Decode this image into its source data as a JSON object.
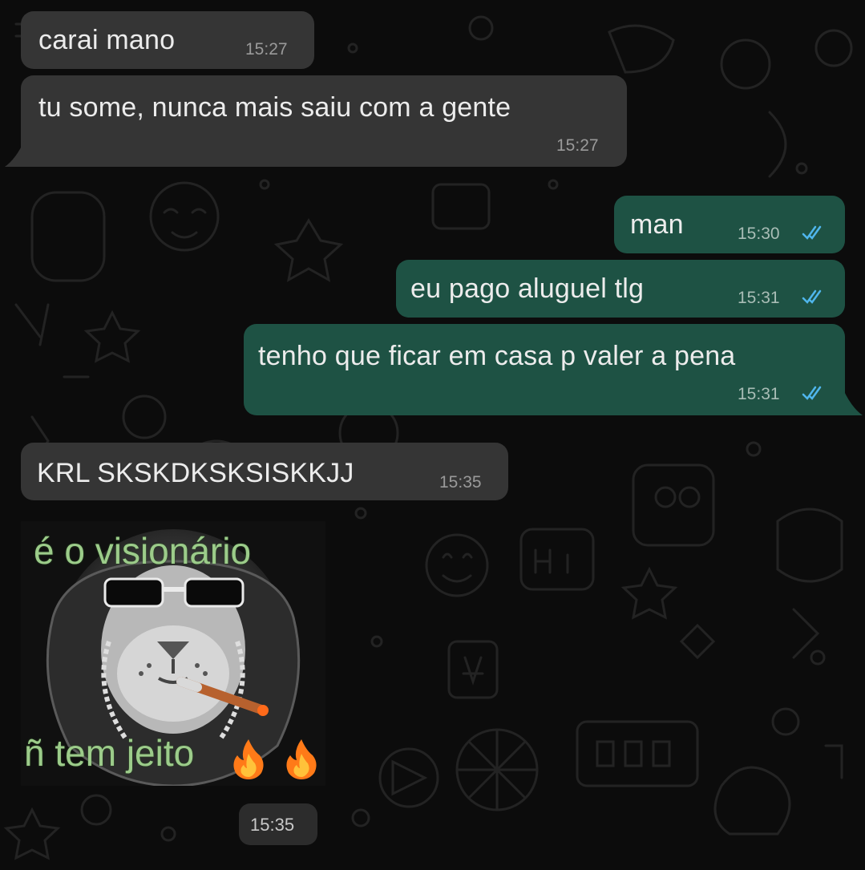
{
  "messages": [
    {
      "direction": "incoming",
      "text": "carai mano",
      "time": "15:27"
    },
    {
      "direction": "incoming",
      "text": "tu some, nunca mais saiu com a gente",
      "time": "15:27"
    },
    {
      "direction": "outgoing",
      "text": "man",
      "time": "15:30",
      "status": "read"
    },
    {
      "direction": "outgoing",
      "text": "eu pago aluguel tlg",
      "time": "15:31",
      "status": "read"
    },
    {
      "direction": "outgoing",
      "text": "tenho que ficar em casa p valer a pena",
      "time": "15:31",
      "status": "read"
    },
    {
      "direction": "incoming",
      "text": "KRL SKSKDKSKSISKKJJ",
      "time": "15:35"
    }
  ],
  "sticker": {
    "top_text": "é o visionário",
    "bottom_text": "ñ tem jeito",
    "time": "15:35",
    "emoji": "fire-icon"
  },
  "colors": {
    "incoming_bubble": "#353535",
    "outgoing_bubble": "#1e5244",
    "read_ticks": "#4fb6ec",
    "background": "#0c0c0c"
  }
}
